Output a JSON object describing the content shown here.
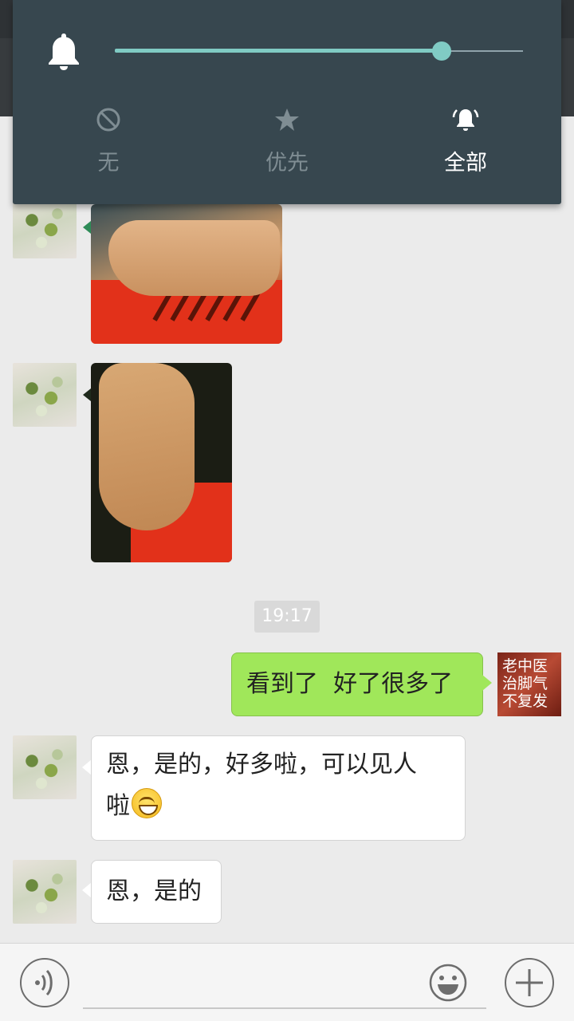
{
  "volume_panel": {
    "level_fraction": 0.8,
    "modes": [
      {
        "label": "无",
        "icon": "block-icon",
        "active": false
      },
      {
        "label": "优先",
        "icon": "star-icon",
        "active": false
      },
      {
        "label": "全部",
        "icon": "bell-ringing-icon",
        "active": true
      }
    ],
    "accent_color": "#80cbc4",
    "panel_color": "#37474f"
  },
  "chat": {
    "timestamp": "19:17",
    "outgoing_message": "看到了  好了很多了",
    "ad_avatar_text": [
      "老中医",
      "治脚气",
      "不复发"
    ],
    "incoming_message_1_line1": "恩，是的，好多啦，可以见人",
    "incoming_message_1_line2": "啦",
    "incoming_message_2": "恩，是的",
    "bubble_out_color": "#a0e75a"
  },
  "input_bar": {
    "icons": [
      "voice-icon",
      "emoji-icon",
      "plus-icon"
    ]
  }
}
